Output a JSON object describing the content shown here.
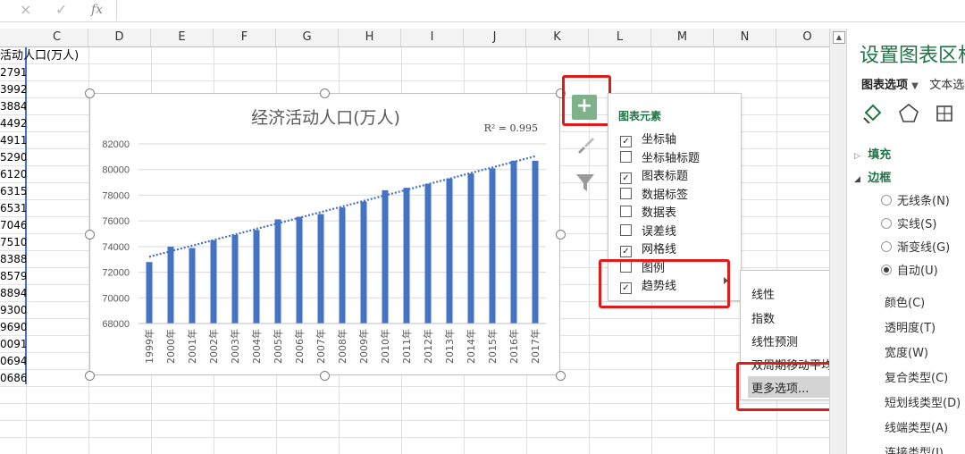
{
  "formula_bar": {
    "cancel_icon": "×",
    "confirm_icon": "✓",
    "fx_label": "fx"
  },
  "columns": [
    "C",
    "D",
    "E",
    "F",
    "G",
    "H",
    "I",
    "J",
    "K",
    "L",
    "M",
    "N",
    "O"
  ],
  "header_cell": "活动人口(万人)",
  "b_column_values": [
    "2791",
    "3992",
    "3884",
    "4492",
    "4911",
    "5290",
    "6120",
    "6315",
    "6531",
    "7046",
    "7510",
    "8388",
    "8579",
    "8894",
    "9300",
    "9690",
    "0091",
    "0694",
    "0686"
  ],
  "chart_data": {
    "type": "bar",
    "title": "经济活动人口(万人)",
    "annotation": "R² = 0.995",
    "categories": [
      "1999年",
      "2000年",
      "2001年",
      "2002年",
      "2003年",
      "2004年",
      "2005年",
      "2006年",
      "2007年",
      "2008年",
      "2009年",
      "2010年",
      "2011年",
      "2012年",
      "2013年",
      "2014年",
      "2015年",
      "2016年",
      "2017年"
    ],
    "values": [
      72791,
      73992,
      73884,
      74492,
      74911,
      75290,
      76120,
      76315,
      76531,
      77046,
      77510,
      78388,
      78579,
      78894,
      79300,
      79690,
      80091,
      80694,
      80686
    ],
    "ylim": [
      68000,
      82000
    ],
    "yticks": [
      "82000",
      "80000",
      "78000",
      "76000",
      "74000",
      "72000",
      "70000",
      "68000"
    ],
    "trendline": "linear (dotted)",
    "bar_color": "#4472c4",
    "grid": true
  },
  "chart_elements": {
    "title": "图表元素",
    "items": [
      {
        "label": "坐标轴",
        "checked": true
      },
      {
        "label": "坐标轴标题",
        "checked": false
      },
      {
        "label": "图表标题",
        "checked": true
      },
      {
        "label": "数据标签",
        "checked": false
      },
      {
        "label": "数据表",
        "checked": false
      },
      {
        "label": "误差线",
        "checked": false
      },
      {
        "label": "网格线",
        "checked": true
      },
      {
        "label": "图例",
        "checked": false
      },
      {
        "label": "趋势线",
        "checked": true
      }
    ]
  },
  "trend_submenu": {
    "items": [
      "线性",
      "指数",
      "线性预测",
      "双周期移动平均"
    ],
    "more": "更多选项..."
  },
  "format_pane": {
    "title": "设置图表区格式",
    "tab_chart": "图表选项",
    "tab_text": "文本选项",
    "section_fill": "填充",
    "section_border": "边框",
    "radios": [
      {
        "label": "无线条(N)",
        "on": false
      },
      {
        "label": "实线(S)",
        "on": false
      },
      {
        "label": "渐变线(G)",
        "on": false
      },
      {
        "label": "自动(U)",
        "on": true
      }
    ],
    "props": [
      "颜色(C)",
      "透明度(T)",
      "宽度(W)",
      "复合类型(C)",
      "短划线类型(D)",
      "线端类型(A)",
      "连接类型(J)"
    ]
  },
  "colors": {
    "accent": "#217346",
    "highlight": "#e31a1a",
    "bar": "#4472c4"
  }
}
